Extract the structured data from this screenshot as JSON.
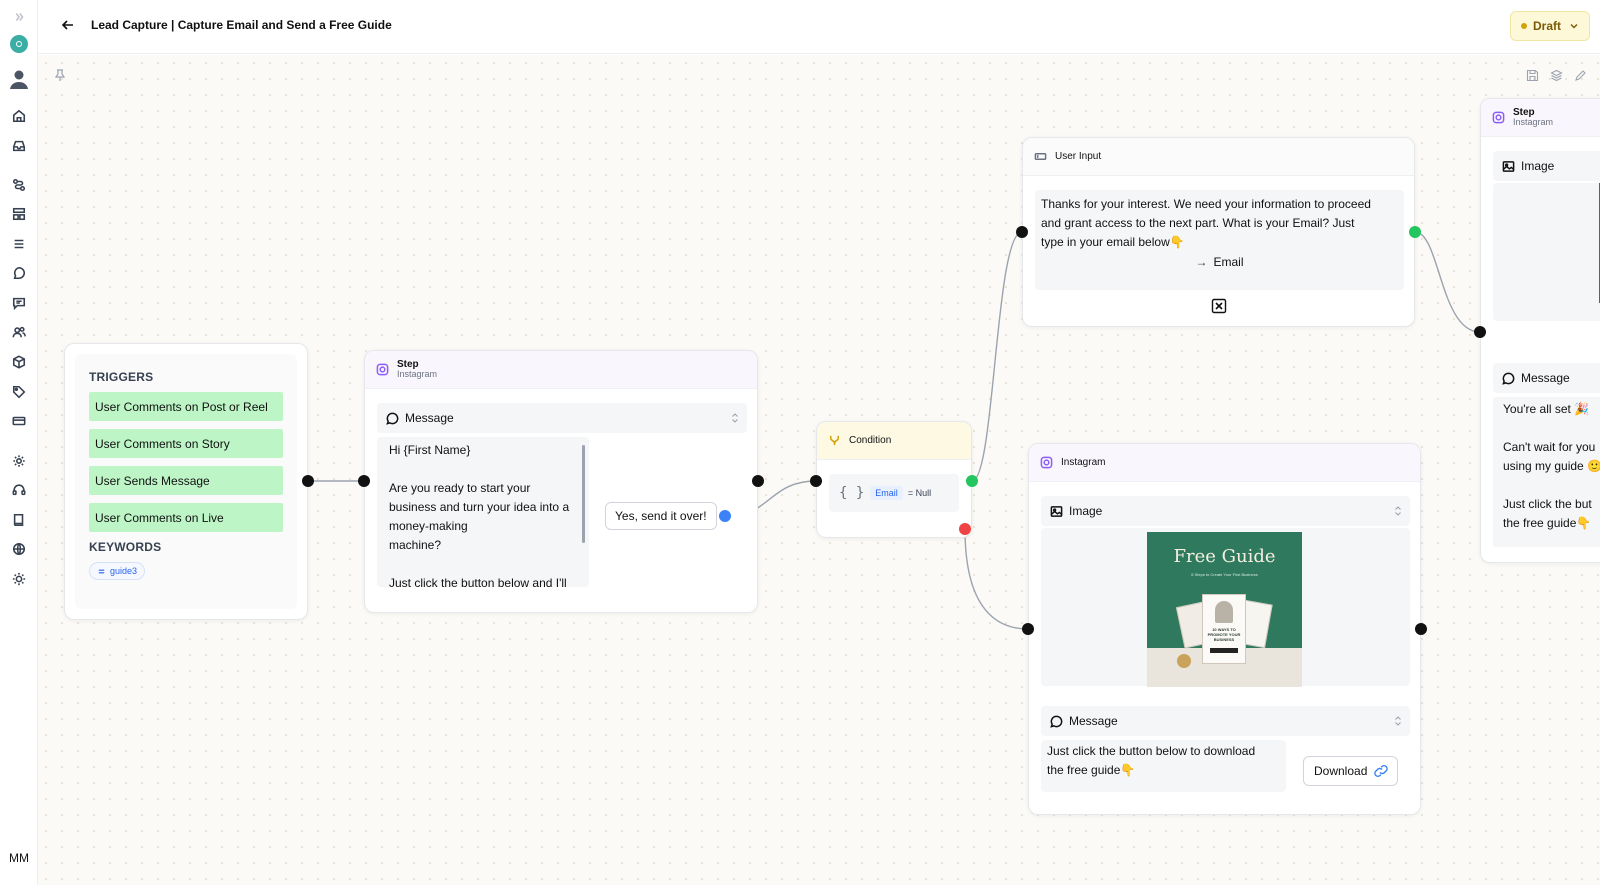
{
  "header": {
    "title": "Lead Capture | Capture Email and Send a Free Guide",
    "status": "Draft"
  },
  "user": {
    "initials": "MM"
  },
  "triggers_card": {
    "triggers_label": "TRIGGERS",
    "triggers": [
      "User Comments on Post or Reel",
      "User Comments on Story",
      "User Sends Message",
      "User Comments on Live"
    ],
    "keywords_label": "KEYWORDS",
    "keywords": [
      "guide3"
    ]
  },
  "step1": {
    "title": "Step",
    "subtitle": "Instagram",
    "message_label": "Message",
    "message_lines": [
      "Hi {First Name}",
      "",
      "Are you ready to start your",
      "business and turn your idea into a",
      "money-making",
      "machine?",
      "",
      "Just click the button below and I'll"
    ],
    "button_label": "Yes, send it over!"
  },
  "condition": {
    "title": "Condition",
    "field": "Email",
    "operator": "= Null"
  },
  "user_input": {
    "title": "User Input",
    "prompt_lines": [
      "Thanks for your interest. We need your information to proceed",
      "and grant access to the next part. What is your Email? Just",
      "type in your email below👇"
    ],
    "save_to": "Email"
  },
  "step_instagram_b": {
    "title": "Instagram",
    "image_label": "Image",
    "guide_image": {
      "title": "Free Guide",
      "subtitle": "6 Steps to Create Your First Business",
      "book_text": "10 WAYS TO PROMOTE YOUR BUSINESS"
    },
    "message_label": "Message",
    "message_lines": [
      "Just click the button below to download",
      "the free guide👇"
    ],
    "button_label": "Download"
  },
  "step_right": {
    "title": "Step",
    "subtitle": "Instagram",
    "image_label": "Image",
    "message_label": "Message",
    "message_lines": [
      "You're all set 🎉",
      "",
      "Can't wait for you",
      "using my guide 🙂",
      "",
      "Just click the but",
      "the free guide👇"
    ]
  },
  "colors": {
    "trigger_bg": "#bdf5c6",
    "success": "#22c55e",
    "fail": "#ef4444",
    "button_port": "#3b82f6",
    "instagram_accent": "#8b5cf6",
    "draft_bg": "#fdf8d8",
    "guide_green": "#2f7a5e"
  }
}
